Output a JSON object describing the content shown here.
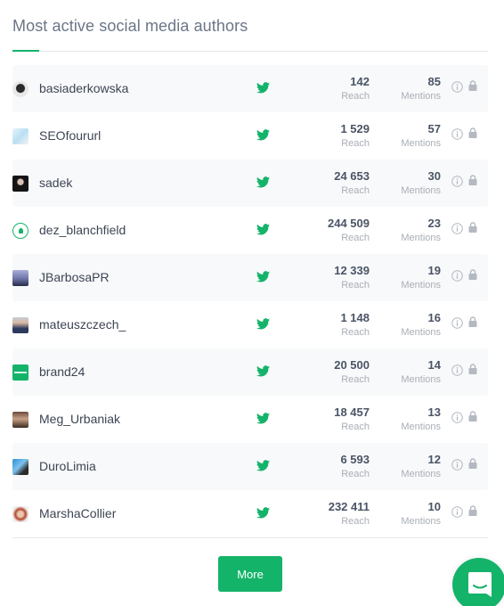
{
  "widget": {
    "title": "Most active social media authors",
    "more_label": "More",
    "reach_label": "Reach",
    "mentions_label": "Mentions",
    "accent_color": "#14b36a"
  },
  "authors": [
    {
      "name": "basiaderkowska",
      "platform": "twitter-icon",
      "reach": "142",
      "mentions": "85"
    },
    {
      "name": "SEOfoururl",
      "platform": "twitter-icon",
      "reach": "1 529",
      "mentions": "57"
    },
    {
      "name": "sadek",
      "platform": "twitter-icon",
      "reach": "24 653",
      "mentions": "30"
    },
    {
      "name": "dez_blanchfield",
      "platform": "twitter-icon",
      "reach": "244 509",
      "mentions": "23"
    },
    {
      "name": "JBarbosaPR",
      "platform": "twitter-icon",
      "reach": "12 339",
      "mentions": "19"
    },
    {
      "name": "mateuszczech_",
      "platform": "twitter-icon",
      "reach": "1 148",
      "mentions": "16"
    },
    {
      "name": "brand24",
      "platform": "twitter-icon",
      "reach": "20 500",
      "mentions": "14"
    },
    {
      "name": "Meg_Urbaniak",
      "platform": "twitter-icon",
      "reach": "18 457",
      "mentions": "13"
    },
    {
      "name": "DuroLimia",
      "platform": "twitter-icon",
      "reach": "6 593",
      "mentions": "12"
    },
    {
      "name": "MarshaCollier",
      "platform": "twitter-icon",
      "reach": "232 411",
      "mentions": "10"
    }
  ],
  "chat": {
    "icon": "chat-bubble-icon"
  }
}
